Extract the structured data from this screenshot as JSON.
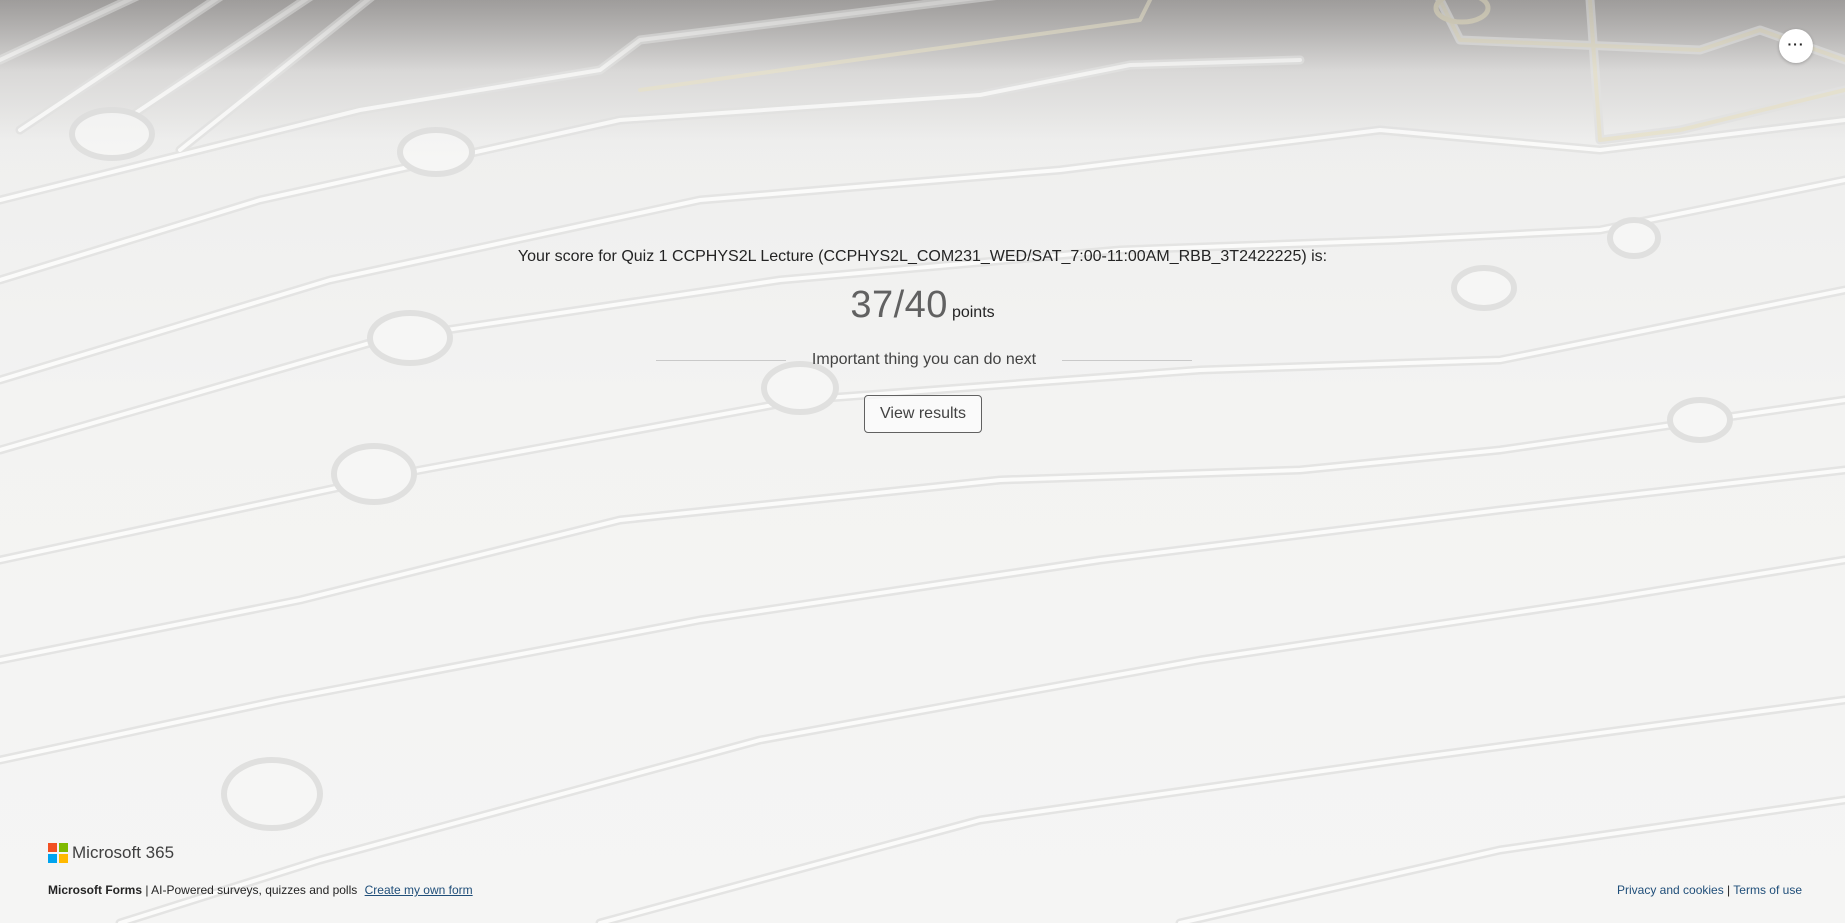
{
  "header": {
    "more_icon": "more-horizontal-icon",
    "more_glyph": "···"
  },
  "result": {
    "title": "Your score for Quiz 1 CCPHYS2L Lecture (CCPHYS2L_COM231_WED/SAT_7:00-11:00AM_RBB_3T2422225) is:",
    "score": "37/40",
    "unit": "points",
    "next_label": "Important thing you can do next",
    "view_results_label": "View results"
  },
  "footer": {
    "brand": "Microsoft 365",
    "logo_colors": [
      "#f25022",
      "#7fba00",
      "#00a4ef",
      "#ffb900"
    ],
    "forms_name": "Microsoft Forms",
    "separator": "|",
    "tagline": "AI-Powered surveys, quizzes and polls",
    "create_link": "Create my own form",
    "privacy_link": "Privacy and cookies",
    "terms_link": "Terms of use"
  }
}
